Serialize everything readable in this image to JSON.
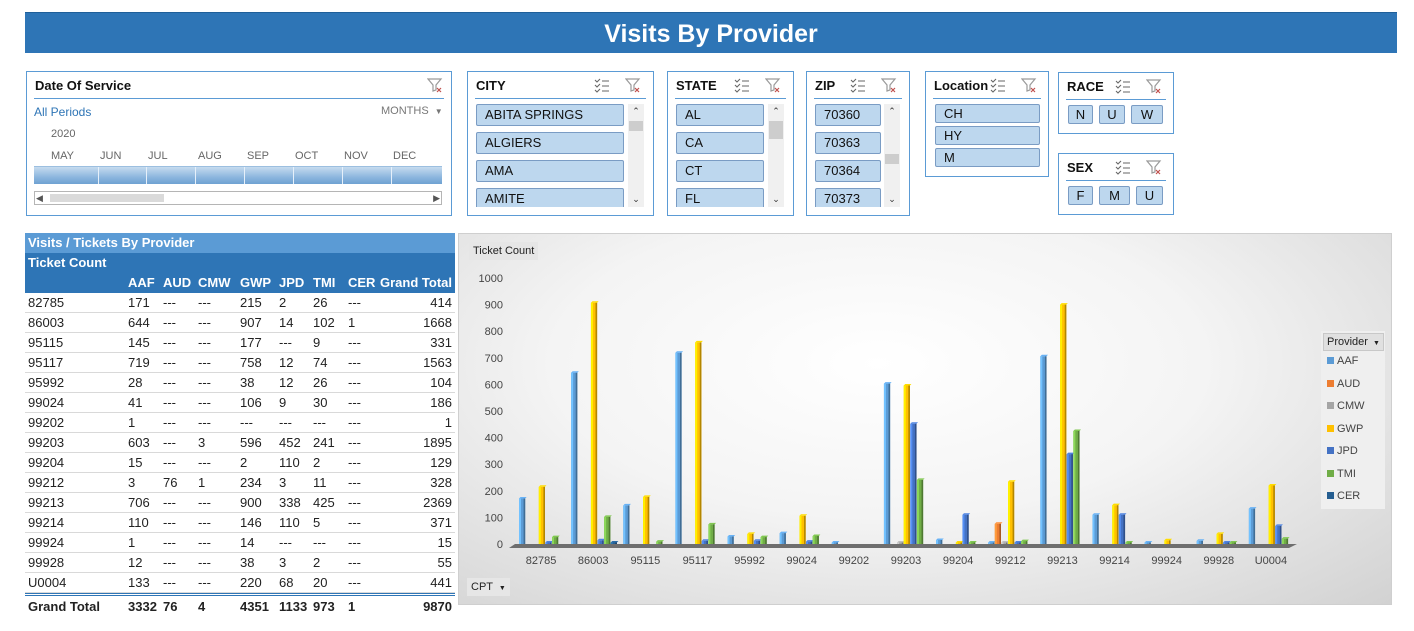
{
  "title": "Visits By Provider",
  "date_slicer": {
    "header": "Date Of Service",
    "all_periods": "All Periods",
    "granularity": "MONTHS",
    "year": "2020",
    "months": [
      "MAY",
      "JUN",
      "JUL",
      "AUG",
      "SEP",
      "OCT",
      "NOV",
      "DEC"
    ]
  },
  "city_slicer": {
    "header": "CITY",
    "items": [
      "ABITA SPRINGS",
      "ALGIERS",
      "AMA",
      "AMITE"
    ]
  },
  "state_slicer": {
    "header": "STATE",
    "items": [
      "AL",
      "CA",
      "CT",
      "FL"
    ]
  },
  "zip_slicer": {
    "header": "ZIP",
    "items": [
      "70360",
      "70363",
      "70364",
      "70373"
    ]
  },
  "location_slicer": {
    "header": "Location",
    "items": [
      "CH",
      "HY",
      "M"
    ]
  },
  "race_slicer": {
    "header": "RACE",
    "items": [
      "N",
      "U",
      "W"
    ]
  },
  "sex_slicer": {
    "header": "SEX",
    "items": [
      "F",
      "M",
      "U"
    ]
  },
  "pivot": {
    "title": "Visits / Tickets By Provider",
    "subtitle": "Ticket Count",
    "columns": [
      "AAF",
      "AUD",
      "CMW",
      "GWP",
      "JPD",
      "TMI",
      "CER",
      "Grand Total"
    ],
    "rows": [
      {
        "label": "82785",
        "cells": [
          "171",
          "---",
          "---",
          "215",
          "2",
          "26",
          "---",
          "414"
        ]
      },
      {
        "label": "86003",
        "cells": [
          "644",
          "---",
          "---",
          "907",
          "14",
          "102",
          "1",
          "1668"
        ]
      },
      {
        "label": "95115",
        "cells": [
          "145",
          "---",
          "---",
          "177",
          "---",
          "9",
          "---",
          "331"
        ]
      },
      {
        "label": "95117",
        "cells": [
          "719",
          "---",
          "---",
          "758",
          "12",
          "74",
          "---",
          "1563"
        ]
      },
      {
        "label": "95992",
        "cells": [
          "28",
          "---",
          "---",
          "38",
          "12",
          "26",
          "---",
          "104"
        ]
      },
      {
        "label": "99024",
        "cells": [
          "41",
          "---",
          "---",
          "106",
          "9",
          "30",
          "---",
          "186"
        ]
      },
      {
        "label": "99202",
        "cells": [
          "1",
          "---",
          "---",
          "---",
          "---",
          "---",
          "---",
          "1"
        ]
      },
      {
        "label": "99203",
        "cells": [
          "603",
          "---",
          "3",
          "596",
          "452",
          "241",
          "---",
          "1895"
        ]
      },
      {
        "label": "99204",
        "cells": [
          "15",
          "---",
          "---",
          "2",
          "110",
          "2",
          "---",
          "129"
        ]
      },
      {
        "label": "99212",
        "cells": [
          "3",
          "76",
          "1",
          "234",
          "3",
          "11",
          "---",
          "328"
        ]
      },
      {
        "label": "99213",
        "cells": [
          "706",
          "---",
          "---",
          "900",
          "338",
          "425",
          "---",
          "2369"
        ]
      },
      {
        "label": "99214",
        "cells": [
          "110",
          "---",
          "---",
          "146",
          "110",
          "5",
          "---",
          "371"
        ]
      },
      {
        "label": "99924",
        "cells": [
          "1",
          "---",
          "---",
          "14",
          "---",
          "---",
          "---",
          "15"
        ]
      },
      {
        "label": "99928",
        "cells": [
          "12",
          "---",
          "---",
          "38",
          "3",
          "2",
          "---",
          "55"
        ]
      },
      {
        "label": "U0004",
        "cells": [
          "133",
          "---",
          "---",
          "220",
          "68",
          "20",
          "---",
          "441"
        ]
      }
    ],
    "total": {
      "label": "Grand Total",
      "cells": [
        "3332",
        "76",
        "4",
        "4351",
        "1133",
        "973",
        "1",
        "9870"
      ]
    }
  },
  "chart": {
    "value_button": "Ticket Count",
    "axis_button": "CPT",
    "legend_title": "Provider"
  },
  "chart_data": {
    "type": "bar",
    "categories": [
      "82785",
      "86003",
      "95115",
      "95117",
      "95992",
      "99024",
      "99202",
      "99203",
      "99204",
      "99212",
      "99213",
      "99214",
      "99924",
      "99928",
      "U0004"
    ],
    "ylim": [
      0,
      1000
    ],
    "yticks": [
      0,
      100,
      200,
      300,
      400,
      500,
      600,
      700,
      800,
      900,
      1000
    ],
    "grid": false,
    "legend_position": "right",
    "series": [
      {
        "name": "AAF",
        "color": "#5b9bd5",
        "values": [
          171,
          644,
          145,
          719,
          28,
          41,
          1,
          603,
          15,
          3,
          706,
          110,
          1,
          12,
          133
        ]
      },
      {
        "name": "AUD",
        "color": "#ed7d31",
        "values": [
          0,
          0,
          0,
          0,
          0,
          0,
          0,
          0,
          0,
          76,
          0,
          0,
          0,
          0,
          0
        ]
      },
      {
        "name": "CMW",
        "color": "#a5a5a5",
        "values": [
          0,
          0,
          0,
          0,
          0,
          0,
          0,
          3,
          0,
          1,
          0,
          0,
          0,
          0,
          0
        ]
      },
      {
        "name": "GWP",
        "color": "#ffc000",
        "values": [
          215,
          907,
          177,
          758,
          38,
          106,
          0,
          596,
          2,
          234,
          900,
          146,
          14,
          38,
          220
        ]
      },
      {
        "name": "JPD",
        "color": "#4472c4",
        "values": [
          2,
          14,
          0,
          12,
          12,
          9,
          0,
          452,
          110,
          3,
          338,
          110,
          0,
          3,
          68
        ]
      },
      {
        "name": "TMI",
        "color": "#70ad47",
        "values": [
          26,
          102,
          9,
          74,
          26,
          30,
          0,
          241,
          2,
          11,
          425,
          5,
          0,
          2,
          20
        ]
      },
      {
        "name": "CER",
        "color": "#255e91",
        "values": [
          0,
          1,
          0,
          0,
          0,
          0,
          0,
          0,
          0,
          0,
          0,
          0,
          0,
          0,
          0
        ]
      }
    ]
  }
}
